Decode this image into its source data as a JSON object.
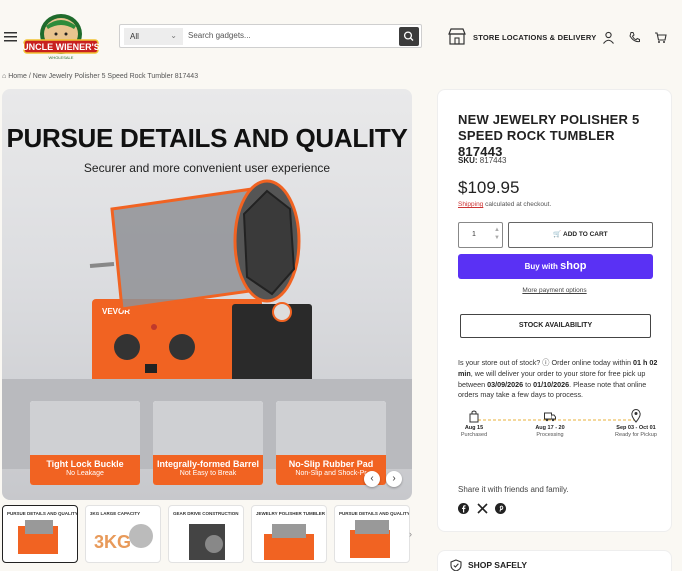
{
  "header": {
    "logo_text": "UNCLE WIENER'S",
    "search": {
      "category": "All",
      "placeholder": "Search gadgets..."
    },
    "store_link": "STORE LOCATIONS & DELIVERY"
  },
  "breadcrumb": {
    "home": "Home",
    "sep": "/",
    "current": "New Jewelry Polisher 5 Speed Rock Tumbler 817443"
  },
  "hero": {
    "title": "PURSUE DETAILS AND QUALITY",
    "subtitle": "Securer and more convenient user experience",
    "brand": "VEVOR",
    "features": [
      {
        "title": "Tight Lock Buckle",
        "sub": "No Leakage"
      },
      {
        "title": "Integrally-formed Barrel",
        "sub": "Not Easy to Break"
      },
      {
        "title": "No-Slip Rubber Pad",
        "sub": "Non-Slip and Shock-Pr"
      }
    ]
  },
  "thumbnails": [
    {
      "label": "PURSUE DETAILS AND QUALITY"
    },
    {
      "label": "3KG LARGE CAPACITY"
    },
    {
      "label": "GEAR DRIVE CONSTRUCTION"
    },
    {
      "label": "JEWELRY POLISHER TUMBLER"
    },
    {
      "label": "PURSUE DETAILS AND QUALITY"
    }
  ],
  "product": {
    "title": "NEW JEWELRY POLISHER 5 SPEED ROCK TUMBLER 817443",
    "sku_label": "SKU:",
    "sku": "817443",
    "price": "$109.95",
    "shipping_link": "Shipping",
    "shipping_text": "calculated at checkout.",
    "quantity": "1",
    "add_to_cart": "ADD TO CART",
    "buy_with": "Buy with",
    "shop_brand": "shop",
    "more_payment": "More payment options",
    "stock_btn": "STOCK AVAILABILITY",
    "notice": {
      "p1": "Is your store out of stock? ",
      "p2": " Order online today within ",
      "time": "01 h 02 min",
      "p3": ", we will deliver your order to your store for free pick up between ",
      "date1": "03/09/2026",
      "p4": " to ",
      "date2": "01/10/2026",
      "p5": ". Please note that online orders may take a few days to process."
    },
    "steps": [
      {
        "date": "Aug 15",
        "label": "Purchased"
      },
      {
        "date": "Aug 17 - 20",
        "label": "Processing"
      },
      {
        "date": "Sep 03 - Oct 01",
        "label": "Ready for Pickup"
      }
    ],
    "share": "Share it with friends and family.",
    "shop_safely": "SHOP SAFELY"
  },
  "colors": {
    "accent": "#f16322",
    "shop_pay": "#5a31f4",
    "panel": "#ffffff",
    "bg": "#faf8f3",
    "timeline": "#e8b23a"
  }
}
